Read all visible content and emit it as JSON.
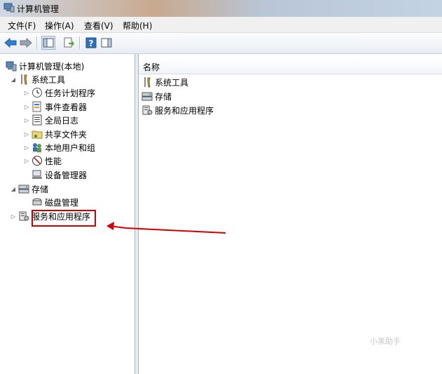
{
  "window": {
    "title": "计算机管理"
  },
  "menu": [
    {
      "label": "文件(F)"
    },
    {
      "label": "操作(A)"
    },
    {
      "label": "查看(V)"
    },
    {
      "label": "帮助(H)"
    }
  ],
  "tree": {
    "root": "计算机管理(本地)",
    "system_tools": {
      "label": "系统工具",
      "children": [
        "任务计划程序",
        "事件查看器",
        "全局日志",
        "共享文件夹",
        "本地用户和组",
        "性能",
        "设备管理器"
      ]
    },
    "storage": {
      "label": "存储",
      "children": [
        "磁盘管理"
      ]
    },
    "services": {
      "label": "服务和应用程序"
    }
  },
  "list": {
    "column": "名称",
    "items": [
      "系统工具",
      "存储",
      "服务和应用程序"
    ]
  },
  "watermark": "小黑助手",
  "colors": {
    "highlight_box": "#d00000",
    "annotation_arrow": "#d00000"
  }
}
